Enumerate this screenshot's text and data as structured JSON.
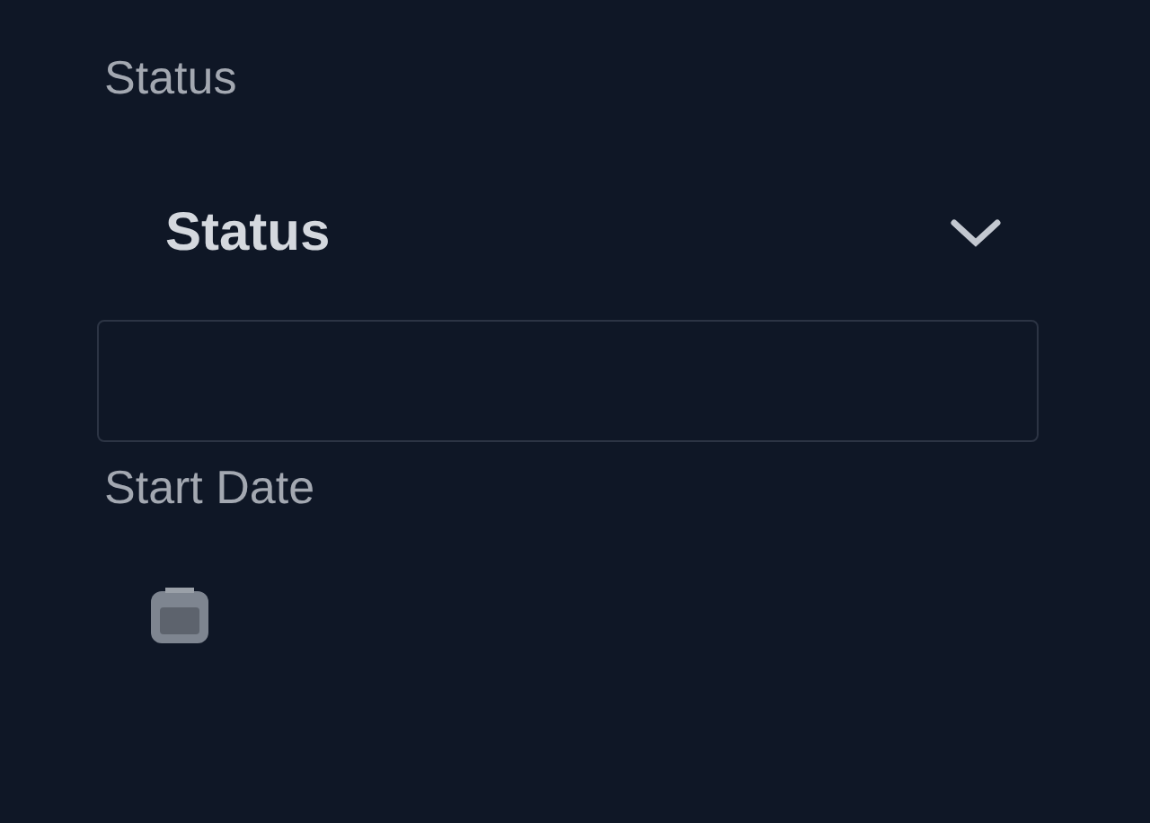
{
  "status_field": {
    "label": "Status",
    "value": "Status"
  },
  "start_date_field": {
    "label": "Start Date"
  }
}
